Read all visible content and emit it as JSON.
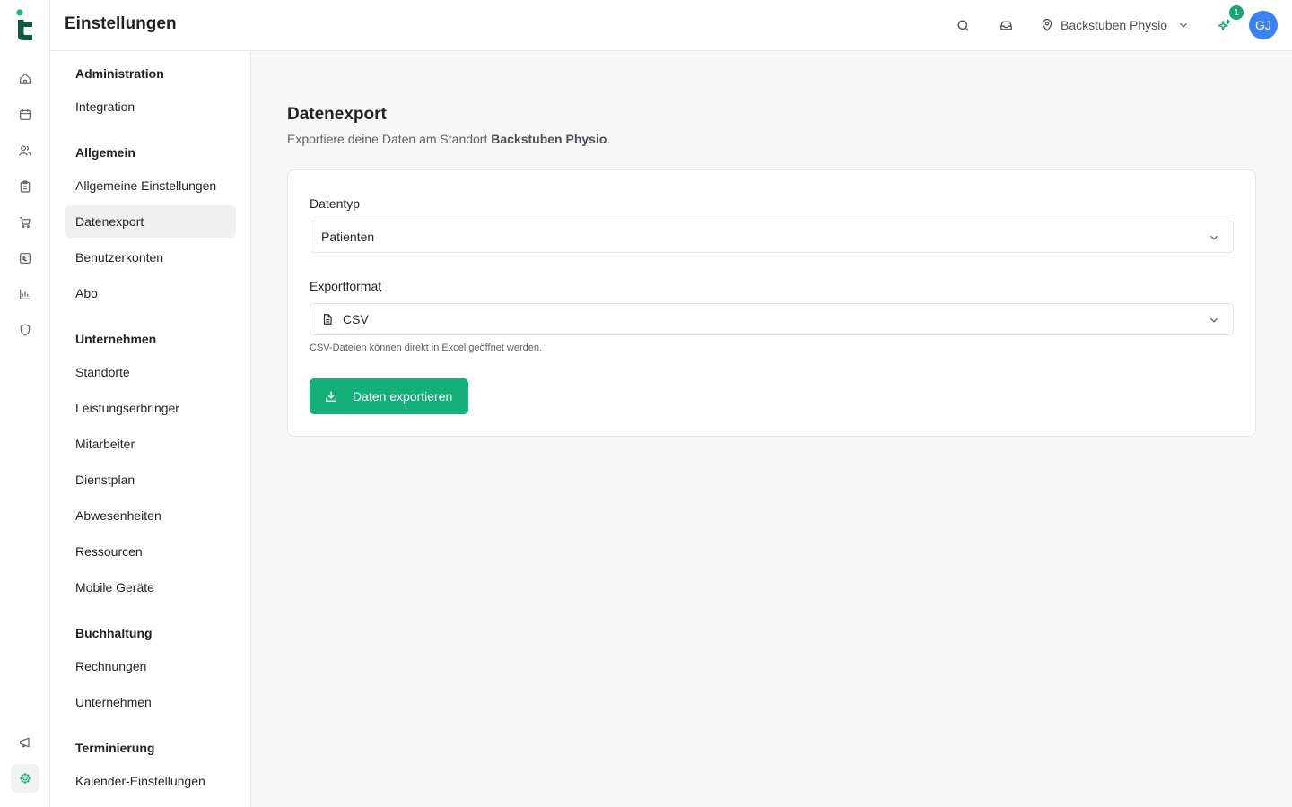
{
  "app": {
    "brand_color": "#13a86b",
    "page_title": "Einstellungen"
  },
  "rail": {
    "icons": [
      "home-icon",
      "calendar-icon",
      "users-icon",
      "clipboard-icon",
      "cart-icon",
      "euro-icon",
      "bar-chart-icon",
      "shield-icon",
      "megaphone-icon",
      "gear-icon"
    ],
    "active": "gear-icon"
  },
  "topbar": {
    "location": "Backstuben Physio",
    "notification_count": "1",
    "avatar_initials": "GJ",
    "avatar_color": "#3b82f6"
  },
  "settings_nav": {
    "sections": [
      {
        "heading": "Administration",
        "items": [
          "Integration"
        ]
      },
      {
        "heading": "Allgemein",
        "items": [
          "Allgemeine Einstellungen",
          "Datenexport",
          "Benutzerkonten",
          "Abo"
        ]
      },
      {
        "heading": "Unternehmen",
        "items": [
          "Standorte",
          "Leistungserbringer",
          "Mitarbeiter",
          "Dienstplan",
          "Abwesenheiten",
          "Ressourcen",
          "Mobile Geräte"
        ]
      },
      {
        "heading": "Buchhaltung",
        "items": [
          "Rechnungen",
          "Unternehmen"
        ]
      },
      {
        "heading": "Terminierung",
        "items": [
          "Kalender-Einstellungen"
        ]
      }
    ],
    "active_item": "Datenexport"
  },
  "main": {
    "title": "Datenexport",
    "subtitle_prefix": "Exportiere deine Daten am Standort ",
    "subtitle_location": "Backstuben Physio",
    "subtitle_suffix": ".",
    "datatype": {
      "label": "Datentyp",
      "value": "Patienten"
    },
    "format": {
      "label": "Exportformat",
      "value": "CSV",
      "hint": "CSV-Dateien können direkt in Excel geöffnet werden."
    },
    "export_button": "Daten exportieren",
    "button_color": "#13b07a"
  }
}
